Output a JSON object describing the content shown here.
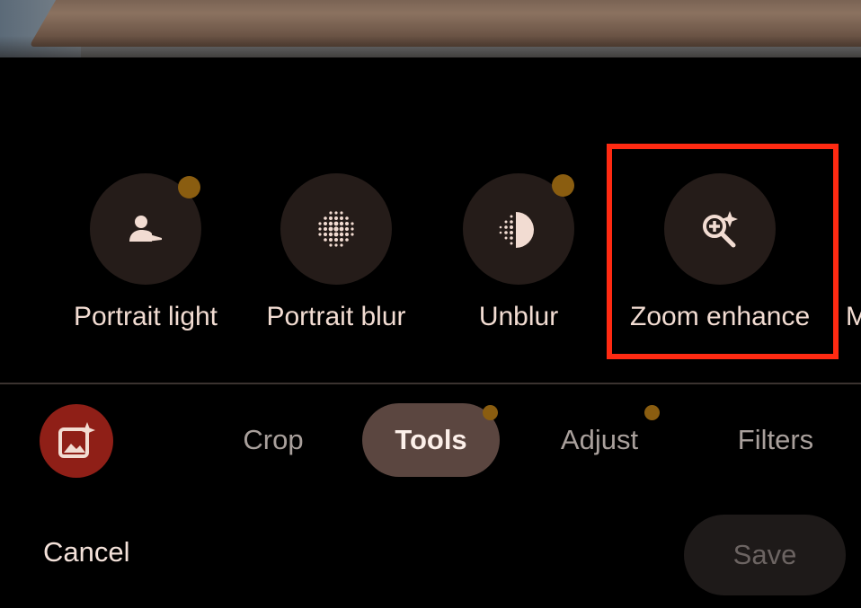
{
  "tools": [
    {
      "label": "Portrait light",
      "icon": "portrait-light-icon",
      "has_dot": true
    },
    {
      "label": "Portrait blur",
      "icon": "portrait-blur-icon",
      "has_dot": false
    },
    {
      "label": "Unblur",
      "icon": "unblur-icon",
      "has_dot": true
    },
    {
      "label": "Zoom enhance",
      "icon": "zoom-enhance-icon",
      "has_dot": false,
      "highlighted": true
    },
    {
      "label": "M",
      "partial": true
    }
  ],
  "tabs": [
    {
      "label": "Crop",
      "active": false,
      "has_dot": false
    },
    {
      "label": "Tools",
      "active": true,
      "has_dot": true
    },
    {
      "label": "Adjust",
      "active": false,
      "has_dot": true
    },
    {
      "label": "Filters",
      "active": false,
      "has_dot": false
    }
  ],
  "actions": {
    "cancel": "Cancel",
    "save": "Save"
  },
  "colors": {
    "background": "#000000",
    "tool_circle": "#251c19",
    "notification_dot": "#8a5d10",
    "highlight_box": "#ff2a12",
    "active_tab": "#5b4640",
    "magic_button": "#8f1f17"
  }
}
